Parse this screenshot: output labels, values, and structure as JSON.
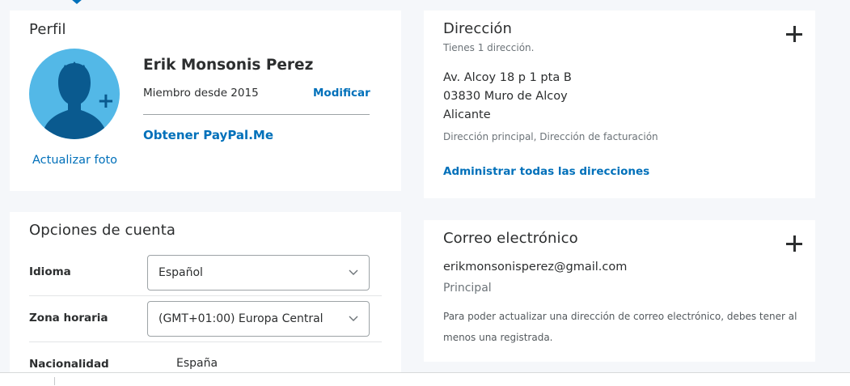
{
  "profile": {
    "title": "Perfil",
    "name": "Erik Monsonis Perez",
    "member_since": "Miembro desde 2015",
    "modify_label": "Modificar",
    "paypalme_label": "Obtener PayPal.Me",
    "update_photo_label": "Actualizar foto",
    "avatar_icon": "user-silhouette-icon",
    "add_photo_icon": "plus-icon"
  },
  "account_options": {
    "title": "Opciones de cuenta",
    "language": {
      "label": "Idioma",
      "value": "Español"
    },
    "timezone": {
      "label": "Zona horaria",
      "value": "(GMT+01:00) Europa Central"
    },
    "nationality": {
      "label": "Nacionalidad",
      "value": "España"
    }
  },
  "address": {
    "title": "Dirección",
    "count_text": "Tienes 1 dirección.",
    "lines": [
      "Av. Alcoy 18 p 1 pta B",
      "03830 Muro de Alcoy",
      "Alicante"
    ],
    "tags": "Dirección principal, Dirección de facturación",
    "manage_label": "Administrar todas las direcciones"
  },
  "email": {
    "title": "Correo electrónico",
    "address": "erikmonsonisperez@gmail.com",
    "status": "Principal",
    "note": "Para poder actualizar una dirección de correo electrónico, debes tener al menos una registrada."
  },
  "colors": {
    "link": "#0070ba",
    "avatar_bg": "#53b8e7",
    "avatar_figure": "#0a5a8f",
    "page_bg": "#f5f7fa"
  }
}
